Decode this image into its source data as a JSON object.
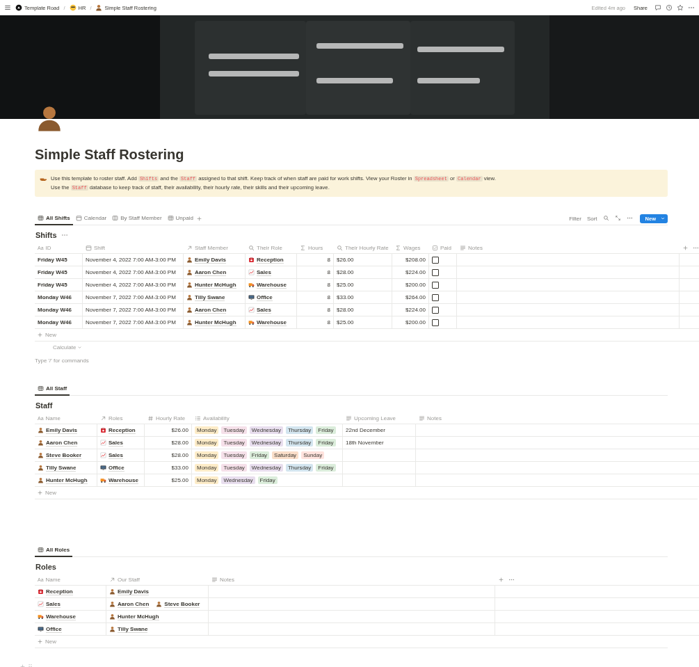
{
  "topbar": {
    "breadcrumbs": [
      {
        "label": "Template Road"
      },
      {
        "label": "HR"
      },
      {
        "label": "Simple Staff Rostering"
      }
    ],
    "separator": "/",
    "edited": "Edited 4m ago",
    "share": "Share"
  },
  "title": "Simple Staff Rostering",
  "callout": {
    "paragraphs": [
      {
        "segments": [
          {
            "text": "Use this template to roster staff. Add "
          },
          {
            "text": "Shifts",
            "code": true
          },
          {
            "text": " and the "
          },
          {
            "text": "Staff",
            "code": true
          },
          {
            "text": " assigned to that shift. Keep track of when staff are paid for work shifts. View your Roster in "
          },
          {
            "text": "Spreadsheet",
            "code": true
          },
          {
            "text": " or "
          },
          {
            "text": "Calendar",
            "code": true
          },
          {
            "text": " view."
          }
        ]
      },
      {
        "segments": [
          {
            "text": "Use the "
          },
          {
            "text": "Staff",
            "code": true
          },
          {
            "text": " database to keep track of staff, their availability, their hourly rate, their skills and their upcoming leave."
          }
        ]
      }
    ]
  },
  "shifts": {
    "views": [
      {
        "label": "All Shifts",
        "kind": "table",
        "selected": true
      },
      {
        "label": "Calendar",
        "kind": "calendar",
        "selected": false
      },
      {
        "label": "By Staff Member",
        "kind": "board",
        "selected": false
      },
      {
        "label": "Unpaid",
        "kind": "table",
        "selected": false
      }
    ],
    "toolbar": {
      "filter": "Filter",
      "sort": "Sort",
      "new": "New"
    },
    "title": "Shifts",
    "columns": [
      {
        "label": "ID",
        "kind": "title",
        "type_label": "Aa"
      },
      {
        "label": "Shift",
        "kind": "date"
      },
      {
        "label": "Staff Member",
        "kind": "relation"
      },
      {
        "label": "Their Role",
        "kind": "rollup"
      },
      {
        "label": "Hours",
        "kind": "formula"
      },
      {
        "label": "Their Hourly Rate",
        "kind": "rollup"
      },
      {
        "label": "Wages",
        "kind": "formula"
      },
      {
        "label": "Paid",
        "kind": "checkbox"
      },
      {
        "label": "Notes",
        "kind": "text"
      }
    ],
    "rows": [
      {
        "cells": [
          {
            "kind": "title",
            "text": "Friday W45"
          },
          {
            "kind": "text",
            "text": "November 4, 2022 7:00 AM-3:00 PM"
          },
          {
            "kind": "person",
            "text": "Emily Davis"
          },
          {
            "kind": "role",
            "role": {
              "kind": "phone",
              "text": "Reception"
            }
          },
          {
            "kind": "number",
            "text": "8"
          },
          {
            "kind": "text",
            "text": "$26.00"
          },
          {
            "kind": "number",
            "text": "$208.00"
          },
          {
            "kind": "checkbox",
            "checked": false
          },
          {
            "kind": "empty"
          }
        ]
      },
      {
        "cells": [
          {
            "kind": "title",
            "text": "Friday W45"
          },
          {
            "kind": "text",
            "text": "November 4, 2022 7:00 AM-3:00 PM"
          },
          {
            "kind": "person",
            "text": "Aaron Chen"
          },
          {
            "kind": "role",
            "role": {
              "kind": "chart",
              "text": "Sales"
            }
          },
          {
            "kind": "number",
            "text": "8"
          },
          {
            "kind": "text",
            "text": "$28.00"
          },
          {
            "kind": "number",
            "text": "$224.00"
          },
          {
            "kind": "checkbox",
            "checked": false
          },
          {
            "kind": "empty"
          }
        ]
      },
      {
        "cells": [
          {
            "kind": "title",
            "text": "Friday W45"
          },
          {
            "kind": "text",
            "text": "November 4, 2022 7:00 AM-3:00 PM"
          },
          {
            "kind": "person",
            "text": "Hunter McHugh"
          },
          {
            "kind": "role",
            "role": {
              "kind": "truck",
              "text": "Warehouse"
            }
          },
          {
            "kind": "number",
            "text": "8"
          },
          {
            "kind": "text",
            "text": "$25.00"
          },
          {
            "kind": "number",
            "text": "$200.00"
          },
          {
            "kind": "checkbox",
            "checked": false
          },
          {
            "kind": "empty"
          }
        ]
      },
      {
        "cells": [
          {
            "kind": "title",
            "text": "Monday W46"
          },
          {
            "kind": "text",
            "text": "November 7, 2022 7:00 AM-3:00 PM"
          },
          {
            "kind": "person",
            "text": "Tilly Swane"
          },
          {
            "kind": "role",
            "role": {
              "kind": "monitor",
              "text": "Office"
            }
          },
          {
            "kind": "number",
            "text": "8"
          },
          {
            "kind": "text",
            "text": "$33.00"
          },
          {
            "kind": "number",
            "text": "$264.00"
          },
          {
            "kind": "checkbox",
            "checked": false
          },
          {
            "kind": "empty"
          }
        ]
      },
      {
        "cells": [
          {
            "kind": "title",
            "text": "Monday W46"
          },
          {
            "kind": "text",
            "text": "November 7, 2022 7:00 AM-3:00 PM"
          },
          {
            "kind": "person",
            "text": "Aaron Chen"
          },
          {
            "kind": "role",
            "role": {
              "kind": "chart",
              "text": "Sales"
            }
          },
          {
            "kind": "number",
            "text": "8"
          },
          {
            "kind": "text",
            "text": "$28.00"
          },
          {
            "kind": "number",
            "text": "$224.00"
          },
          {
            "kind": "checkbox",
            "checked": false
          },
          {
            "kind": "empty"
          }
        ]
      },
      {
        "cells": [
          {
            "kind": "title",
            "text": "Monday W46"
          },
          {
            "kind": "text",
            "text": "November 7, 2022 7:00 AM-3:00 PM"
          },
          {
            "kind": "person",
            "text": "Hunter McHugh"
          },
          {
            "kind": "role",
            "role": {
              "kind": "truck",
              "text": "Warehouse"
            }
          },
          {
            "kind": "number",
            "text": "8"
          },
          {
            "kind": "text",
            "text": "$25.00"
          },
          {
            "kind": "number",
            "text": "$200.00"
          },
          {
            "kind": "checkbox",
            "checked": false
          },
          {
            "kind": "empty"
          }
        ]
      }
    ],
    "new_row": "New",
    "calculate": "Calculate"
  },
  "command_hint": "Type '/' for commands",
  "staff": {
    "views": [
      {
        "label": "All Staff",
        "kind": "table",
        "selected": true
      }
    ],
    "title": "Staff",
    "columns": [
      {
        "label": "Name",
        "kind": "title",
        "type_label": "Aa"
      },
      {
        "label": "Roles",
        "kind": "relation"
      },
      {
        "label": "Hourly Rate",
        "kind": "number"
      },
      {
        "label": "Availability",
        "kind": "multiselect"
      },
      {
        "label": "Upcoming Leave",
        "kind": "text"
      },
      {
        "label": "Notes",
        "kind": "text"
      }
    ],
    "rows": [
      {
        "cells": [
          {
            "kind": "person",
            "text": "Emily Davis"
          },
          {
            "kind": "role",
            "role": {
              "kind": "phone",
              "text": "Reception"
            }
          },
          {
            "kind": "number",
            "text": "$26.00"
          },
          {
            "kind": "tags",
            "tags": [
              {
                "text": "Monday",
                "color": "#fdecc8"
              },
              {
                "text": "Tuesday",
                "color": "#f5e0e9"
              },
              {
                "text": "Wednesday",
                "color": "#e8deee"
              },
              {
                "text": "Thursday",
                "color": "#d3e5ef"
              },
              {
                "text": "Friday",
                "color": "#dbeddb"
              }
            ]
          },
          {
            "kind": "text",
            "text": "22nd December"
          },
          {
            "kind": "empty"
          }
        ]
      },
      {
        "cells": [
          {
            "kind": "person",
            "text": "Aaron Chen"
          },
          {
            "kind": "role",
            "role": {
              "kind": "chart",
              "text": "Sales"
            }
          },
          {
            "kind": "number",
            "text": "$28.00"
          },
          {
            "kind": "tags",
            "tags": [
              {
                "text": "Monday",
                "color": "#fdecc8"
              },
              {
                "text": "Tuesday",
                "color": "#f5e0e9"
              },
              {
                "text": "Wednesday",
                "color": "#e8deee"
              },
              {
                "text": "Thursday",
                "color": "#d3e5ef"
              },
              {
                "text": "Friday",
                "color": "#dbeddb"
              }
            ]
          },
          {
            "kind": "text",
            "text": "18th November"
          },
          {
            "kind": "empty"
          }
        ]
      },
      {
        "cells": [
          {
            "kind": "person",
            "text": "Steve Booker"
          },
          {
            "kind": "role",
            "role": {
              "kind": "chart",
              "text": "Sales"
            }
          },
          {
            "kind": "number",
            "text": "$28.00"
          },
          {
            "kind": "tags",
            "tags": [
              {
                "text": "Monday",
                "color": "#fdecc8"
              },
              {
                "text": "Tuesday",
                "color": "#f5e0e9"
              },
              {
                "text": "Friday",
                "color": "#dbeddb"
              },
              {
                "text": "Saturday",
                "color": "#fadec9"
              },
              {
                "text": "Sunday",
                "color": "#ffe2dd"
              }
            ]
          },
          {
            "kind": "empty"
          },
          {
            "kind": "empty"
          }
        ]
      },
      {
        "cells": [
          {
            "kind": "person",
            "text": "Tilly Swane"
          },
          {
            "kind": "role",
            "role": {
              "kind": "monitor",
              "text": "Office"
            }
          },
          {
            "kind": "number",
            "text": "$33.00"
          },
          {
            "kind": "tags",
            "tags": [
              {
                "text": "Monday",
                "color": "#fdecc8"
              },
              {
                "text": "Tuesday",
                "color": "#f5e0e9"
              },
              {
                "text": "Wednesday",
                "color": "#e8deee"
              },
              {
                "text": "Thursday",
                "color": "#d3e5ef"
              },
              {
                "text": "Friday",
                "color": "#dbeddb"
              }
            ]
          },
          {
            "kind": "empty"
          },
          {
            "kind": "empty"
          }
        ]
      },
      {
        "cells": [
          {
            "kind": "person",
            "text": "Hunter McHugh"
          },
          {
            "kind": "role",
            "role": {
              "kind": "truck",
              "text": "Warehouse"
            }
          },
          {
            "kind": "number",
            "text": "$25.00"
          },
          {
            "kind": "tags",
            "tags": [
              {
                "text": "Monday",
                "color": "#fdecc8"
              },
              {
                "text": "Wednesday",
                "color": "#e8deee"
              },
              {
                "text": "Friday",
                "color": "#dbeddb"
              }
            ]
          },
          {
            "kind": "empty"
          },
          {
            "kind": "empty"
          }
        ]
      }
    ],
    "new_row": "New"
  },
  "roles": {
    "views": [
      {
        "label": "All Roles",
        "kind": "table",
        "selected": true
      }
    ],
    "title": "Roles",
    "columns": [
      {
        "label": "Name",
        "kind": "title",
        "type_label": "Aa"
      },
      {
        "label": "Our Staff",
        "kind": "relation"
      },
      {
        "label": "Notes",
        "kind": "text"
      }
    ],
    "rows": [
      {
        "cells": [
          {
            "kind": "role",
            "role": {
              "kind": "phone",
              "text": "Reception"
            }
          },
          {
            "kind": "people",
            "people": [
              "Emily Davis"
            ]
          },
          {
            "kind": "empty"
          }
        ]
      },
      {
        "cells": [
          {
            "kind": "role",
            "role": {
              "kind": "chart",
              "text": "Sales"
            }
          },
          {
            "kind": "people",
            "people": [
              "Aaron Chen",
              "Steve Booker"
            ]
          },
          {
            "kind": "empty"
          }
        ]
      },
      {
        "cells": [
          {
            "kind": "role",
            "role": {
              "kind": "truck",
              "text": "Warehouse"
            }
          },
          {
            "kind": "people",
            "people": [
              "Hunter McHugh"
            ]
          },
          {
            "kind": "empty"
          }
        ]
      },
      {
        "cells": [
          {
            "kind": "role",
            "role": {
              "kind": "monitor",
              "text": "Office"
            }
          },
          {
            "kind": "people",
            "people": [
              "Tilly Swane"
            ]
          },
          {
            "kind": "empty"
          }
        ]
      }
    ],
    "new_row": "New"
  }
}
